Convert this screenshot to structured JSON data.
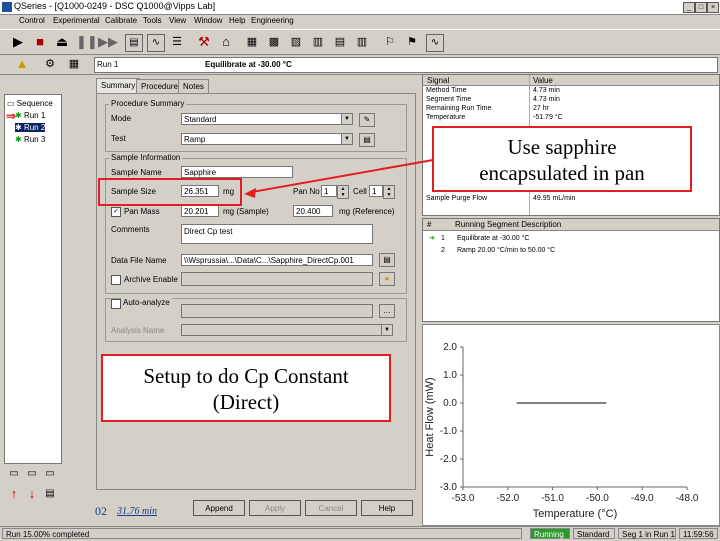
{
  "window": {
    "title": "QSeries - [Q1000-0249 - DSC Q1000@Vipps Lab]"
  },
  "menu": [
    "Control",
    "Experimental",
    "Calibrate",
    "Tools",
    "View",
    "Window",
    "Help",
    "Engineering"
  ],
  "runbar": {
    "prefix": "Run 1",
    "text": "Equilibrate at -30.00 °C"
  },
  "tree": {
    "root": "Sequence",
    "items": [
      "Run 1",
      "Run 2",
      "Run 3"
    ]
  },
  "tabs": [
    "Summary",
    "Procedure",
    "Notes"
  ],
  "form": {
    "procedure_summary_label": "Procedure Summary",
    "mode_label": "Mode",
    "mode_value": "Standard",
    "test_label": "Test",
    "test_value": "Ramp",
    "sample_info_label": "Sample Information",
    "sample_name_label": "Sample Name",
    "sample_name_value": "Sapphire",
    "sample_size_label": "Sample Size",
    "sample_size_value": "26.351",
    "sample_size_unit": "mg",
    "pan_no_label": "Pan No",
    "pan_no_value": "1",
    "cell_label": "Cell",
    "cell_value": "1",
    "pan_mass_label": "Pan Mass",
    "pan_mass_sample": "20.201",
    "pan_mass_sample_unit": "mg (Sample)",
    "pan_mass_ref": "20.400",
    "pan_mass_ref_unit": "mg (Reference)",
    "comments_label": "Comments",
    "comments_value": "Direct Cp test",
    "data_file_label": "Data File Name",
    "data_file_value": "\\\\Wsprussia\\...\\Data\\C...\\Sapphire_DirectCp.001",
    "archive_label": "Archive Enable",
    "autoanalyze_label": "Auto-analyze",
    "analysis_name_label": "Analysis Name"
  },
  "buttons": {
    "append": "Append",
    "apply": "Apply",
    "cancel": "Cancel",
    "help": "Help"
  },
  "footer": {
    "number": "02",
    "time": "31.76 min"
  },
  "signals": {
    "headers": [
      "Signal",
      "Value"
    ],
    "rows": [
      [
        "Method Time",
        "4.73 min"
      ],
      [
        "Segment Time",
        "4.73 min"
      ],
      [
        "Remaining Run Time",
        "27 hr"
      ],
      [
        "Temperature",
        "-51.79 °C"
      ],
      [
        "",
        ""
      ],
      [
        "",
        ""
      ],
      [
        "",
        ""
      ],
      [
        "",
        ""
      ],
      [
        "",
        ""
      ],
      [
        "",
        ""
      ],
      [
        "Sample Purge Flow",
        "49.95 mL/min"
      ]
    ]
  },
  "segments": {
    "headers": [
      "#",
      "Running Segment Description"
    ],
    "rows": [
      [
        "1",
        "Equilibrate at -30.00 °C"
      ],
      [
        "2",
        "Ramp 20.00 °C/min to 50.00 °C"
      ]
    ]
  },
  "callouts": {
    "sapphire": "Use sapphire encapsulated in pan",
    "setup": "Setup to do Cp Constant (Direct)"
  },
  "chart_data": {
    "type": "line",
    "xlabel": "Temperature (°C)",
    "ylabel": "Heat Flow (mW)",
    "xlim": [
      -53.0,
      -48.0
    ],
    "ylim": [
      -3.0,
      2.0
    ],
    "xticks": [
      "-53.0",
      "-52.0",
      "-51.0",
      "-50.0",
      "-49.0",
      "-48.0"
    ],
    "yticks": [
      "2.0",
      "1.0",
      "0.0",
      "-1.0",
      "-2.0",
      "-3.0"
    ],
    "series": [
      {
        "x": [
          -51.8,
          -49.8
        ],
        "y": [
          0.0,
          0.0
        ]
      }
    ]
  },
  "status": {
    "left": "Run 15.00% completed",
    "running": "Running",
    "standard": "Standard",
    "segment": "Seg 1 in Run 1",
    "time": "11:59:56"
  }
}
